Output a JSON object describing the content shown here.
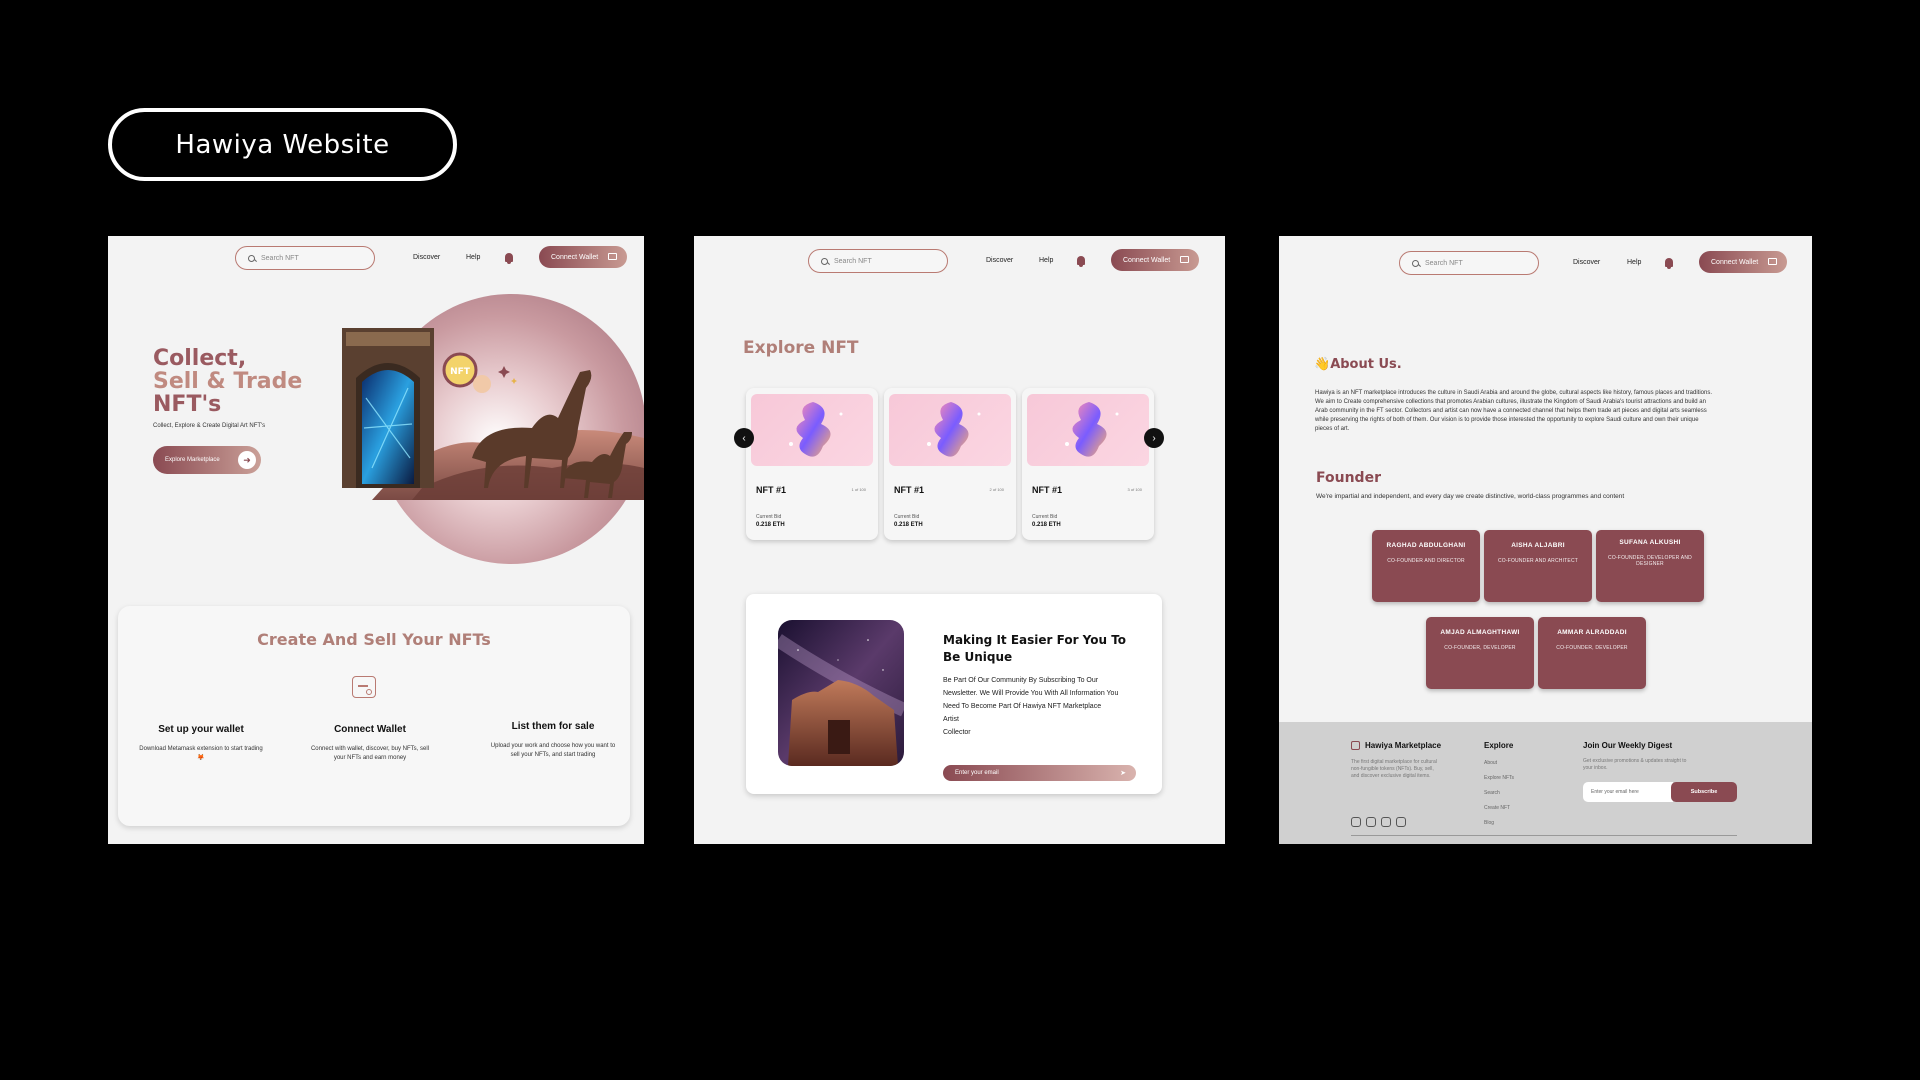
{
  "page_title": "Hawiya Website",
  "header": {
    "search_placeholder": "Search NFT",
    "nav": [
      "Discover",
      "Help"
    ],
    "connect_wallet": "Connect Wallet"
  },
  "home": {
    "hero_lines": [
      "Collect,",
      "Sell & Trade",
      "NFT's"
    ],
    "hero_sub": "Collect, Explore & Create Digital Art NFT's",
    "hero_badge": "NFT",
    "explore_button": "Explore Marketplace",
    "create_title": "Create And Sell Your NFTs",
    "steps": [
      {
        "title": "Set up your wallet",
        "desc": "Download Metamask extension to start trading 🦊"
      },
      {
        "title": "Connect Wallet",
        "desc": "Connect with wallet, discover, buy NFTs, sell your NFTs and earn money"
      },
      {
        "title": "List them for sale",
        "desc": "Upload your work and choose how you want to sell your NFTs, and start trading"
      }
    ]
  },
  "explore": {
    "title": "Explore NFT",
    "cards": [
      {
        "name": "NFT #1",
        "count": "1 of 100",
        "bid_label": "Current Bid",
        "price": "0.218 ETH"
      },
      {
        "name": "NFT #1",
        "count": "2 of 100",
        "bid_label": "Current Bid",
        "price": "0.218 ETH"
      },
      {
        "name": "NFT #1",
        "count": "3 of 100",
        "bid_label": "Current Bid",
        "price": "0.218 ETH"
      }
    ],
    "prev_arrow": "‹",
    "next_arrow": "›",
    "newsletter": {
      "heading": "Making It Easier For You To Be Unique",
      "body": "Be Part Of Our Community By Subscribing To Our Newsletter. We Will Provide You With All Information You Need To Become Part Of Hawiya NFT Marketplace",
      "roles": [
        "Artist",
        "Collector"
      ],
      "email_placeholder": "Enter your email",
      "send_icon": "➤"
    }
  },
  "about": {
    "wave": "👋",
    "heading": "About Us.",
    "body": "Hawiya is an NFT marketplace introduces the culture in Saudi Arabia and around the globe, cultural aspects like history, famous places and traditions. We aim to Create comprehensive collections that promotes Arabian cultures, illustrate the Kingdom of Saudi Arabia's tourist attractions and build an Arab community in the FT sector. Collectors and artist can now have a connected channel that helps them trade art pieces and digital arts seamless while preserving the rights of both of them. Our vision is to provide those interested the opportunity to explore Saudi culture and own their unique pieces of art.",
    "founder_heading": "Founder",
    "founder_sub": "We're impartial and independent, and every day we create distinctive, world-class programmes and content",
    "founders": [
      {
        "name": "RAGHAD ABDULGHANI",
        "role": "CO-FOUNDER AND DIRECTOR"
      },
      {
        "name": "AISHA ALJABRI",
        "role": "CO-FOUNDER AND ARCHITECT"
      },
      {
        "name": "SUFANA ALKUSHI",
        "role": "CO-FOUNDER, DEVELOPER AND DESIGNER"
      },
      {
        "name": "AMJAD ALMAGHTHAWI",
        "role": "CO-FOUNDER, DEVELOPER"
      },
      {
        "name": "AMMAR ALRADDADI",
        "role": "CO-FOUNDER, DEVELOPER"
      }
    ]
  },
  "footer": {
    "brand": "Hawiya Marketplace",
    "desc": "The first digital marketplace for cultural non-fungible tokens (NFTs). Buy, sell, and discover exclusive digital items.",
    "explore_heading": "Explore",
    "links": [
      "About",
      "Explore NFTs",
      "Search",
      "Create NFT",
      "Blog"
    ],
    "digest_heading": "Join Our Weekly Digest",
    "digest_text": "Get exclusive promotions & updates straight to your inbox.",
    "email_placeholder": "Enter your email here",
    "subscribe": "Subscribe"
  }
}
